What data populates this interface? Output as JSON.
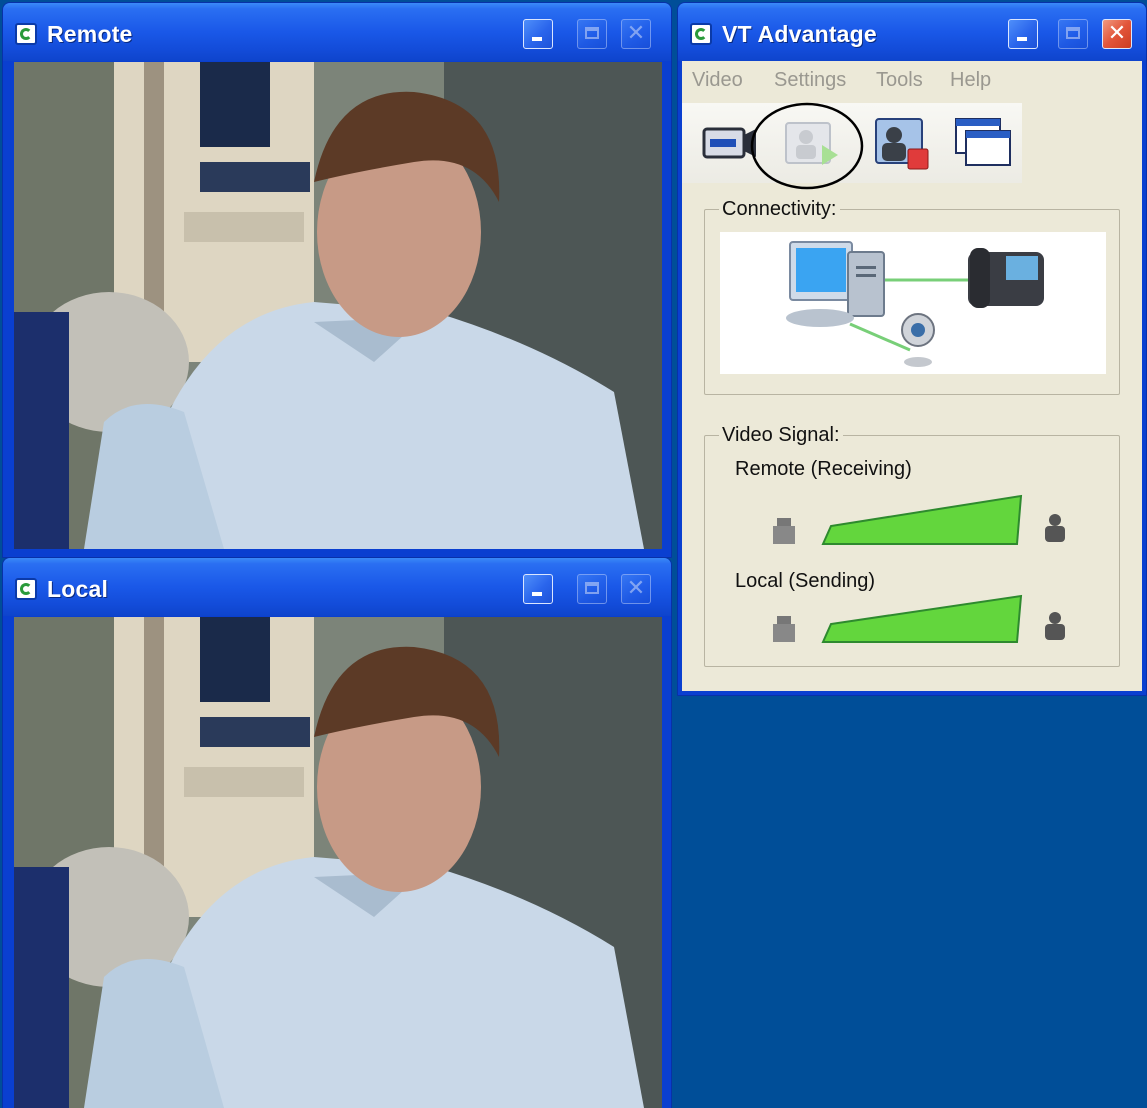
{
  "windows": {
    "remote": {
      "title": "Remote",
      "buttons": {
        "minimize": "minimize",
        "maximize": "maximize",
        "close": "close"
      }
    },
    "local": {
      "title": "Local",
      "buttons": {
        "minimize": "minimize",
        "maximize": "maximize",
        "close": "close"
      }
    },
    "vta": {
      "title": "VT Advantage",
      "menu": [
        "Video",
        "Settings",
        "Tools",
        "Help"
      ],
      "toolbar": [
        {
          "icon": "camera-icon"
        },
        {
          "icon": "start-video-icon",
          "highlighted": true
        },
        {
          "icon": "stop-video-icon"
        },
        {
          "icon": "windows-icon"
        }
      ],
      "connectivity": {
        "label": "Connectivity:"
      },
      "video_signal": {
        "label": "Video Signal:",
        "remote_label": "Remote (Receiving)",
        "local_label": "Local (Sending)"
      }
    }
  },
  "colors": {
    "desktop": "#004e98",
    "titlebar": "#1a58e8",
    "panel": "#ece9d8",
    "signal_green": "#5fd83a",
    "annotation_circle": "#000000"
  }
}
